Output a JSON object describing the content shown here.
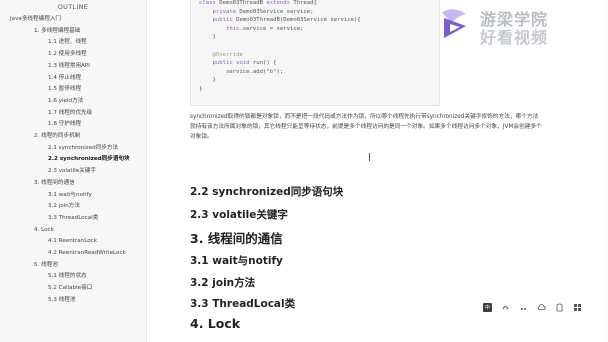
{
  "sidebar": {
    "title": "OUTLINE",
    "items": [
      {
        "label": "Java多线程编程入门",
        "level": 0
      },
      {
        "label": "1. 多线程编程基础",
        "level": 1
      },
      {
        "label": "1.1 进程、线程",
        "level": 2
      },
      {
        "label": "1.2 使用多线程",
        "level": 2
      },
      {
        "label": "1.3 线程常用API",
        "level": 2
      },
      {
        "label": "1.4 停止线程",
        "level": 2
      },
      {
        "label": "1.5 暂停线程",
        "level": 2
      },
      {
        "label": "1.6 yield方法",
        "level": 2
      },
      {
        "label": "1.7 线程的优先级",
        "level": 2
      },
      {
        "label": "1.8 守护线程",
        "level": 2
      },
      {
        "label": "2. 线程的同步机制",
        "level": 1
      },
      {
        "label": "2.1 synchronized同步方法",
        "level": 2
      },
      {
        "label": "2.2 synchronized同步语句块",
        "level": 2,
        "active": true
      },
      {
        "label": "2.3 volatile关键字",
        "level": 2
      },
      {
        "label": "3. 线程间的通信",
        "level": 1
      },
      {
        "label": "3.1 wait与notify",
        "level": 2
      },
      {
        "label": "3.2 join方法",
        "level": 2
      },
      {
        "label": "3.3 ThreadLocal类",
        "level": 2
      },
      {
        "label": "4. Lock",
        "level": 1
      },
      {
        "label": "4.1 ReentranLock",
        "level": 2
      },
      {
        "label": "4.2 ReentranReadWriteLock",
        "level": 2
      },
      {
        "label": "5. 线程池",
        "level": 1
      },
      {
        "label": "5.1 线程的状态",
        "level": 2
      },
      {
        "label": "5.2 Callable接口",
        "level": 2
      },
      {
        "label": "5.3 线程池",
        "level": 2
      }
    ]
  },
  "code": {
    "lines": [
      "class Demo03ThreadB extends Thread{",
      "    private Demo03Service service;",
      "    public Demo03ThreadB(Demo03Service service){",
      "        this.service = service;",
      "    }",
      "",
      "    @Override",
      "    public void run() {",
      "        service.add(\"b\");",
      "    }",
      "}"
    ]
  },
  "content": {
    "paragraph": "synchronized取得的锁都是对象锁，而不是把一段代码或方法作为锁，所以哪个线程先执行带synchronized关键字修饰的方法，哪个方法就持有该方法所属对象的锁，其它线程只能呈等待状态，前提是多个线程访问的是同一个对象。如果多个线程访问多个对象，JVM会创建多个对象锁。",
    "h_2_2": "2.2 synchronized同步语句块",
    "h_2_3": "2.3 volatile关键字",
    "h_3": "3. 线程间的通信",
    "h_3_1": "3.1 wait与notify",
    "h_3_2": "3.2 join方法",
    "h_3_3": "3.3 ThreadLocal类",
    "h_4": "4. Lock"
  },
  "watermark": {
    "line1": "游梁学院",
    "line2": "好看视频"
  },
  "toolbar": {
    "ime_label": "中",
    "icons": [
      "keyboard-icon",
      "ime-icon",
      "dot-icon",
      "cloud-icon",
      "shirt-icon",
      "grid-icon"
    ]
  },
  "colors": {
    "sidebar_bg": "#f7f7f7",
    "code_bg": "#f6f6f6",
    "keyword": "#8d5fc8",
    "logo_purple": "#7a5bd6"
  }
}
